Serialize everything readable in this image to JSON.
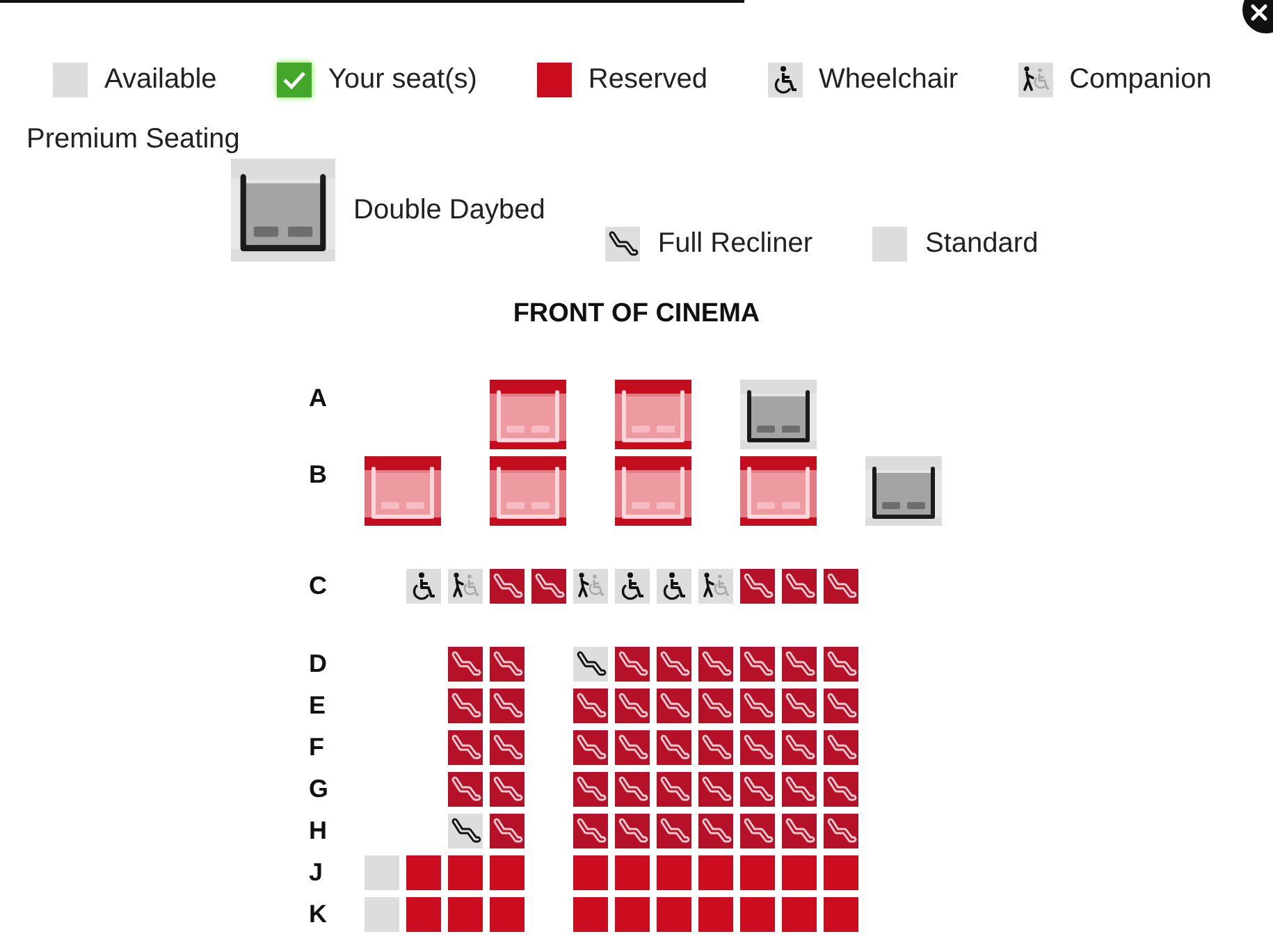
{
  "legend": [
    {
      "kind": "available",
      "label": "Available"
    },
    {
      "kind": "your_seat",
      "label": "Your seat(s)"
    },
    {
      "kind": "reserved",
      "label": "Reserved"
    },
    {
      "kind": "wheelchair",
      "label": "Wheelchair"
    },
    {
      "kind": "companion",
      "label": "Companion"
    }
  ],
  "premium_legend": {
    "title": "Premium Seating",
    "items": [
      {
        "kind": "daybed",
        "label": "Double Daybed"
      },
      {
        "kind": "recliner",
        "label": "Full Recliner"
      },
      {
        "kind": "standard",
        "label": "Standard"
      }
    ]
  },
  "seat_map": {
    "title": "FRONT OF CINEMA",
    "sections": [
      {
        "rows": [
          {
            "label": "A",
            "seats": [
              {
                "kind": "space"
              },
              {
                "kind": "daybed",
                "reserved": true
              },
              {
                "kind": "daybed",
                "reserved": true
              },
              {
                "kind": "daybed",
                "reserved": false
              }
            ]
          },
          {
            "label": "B",
            "seats": [
              {
                "kind": "daybed",
                "reserved": true
              },
              {
                "kind": "daybed",
                "reserved": true
              },
              {
                "kind": "daybed",
                "reserved": true
              },
              {
                "kind": "daybed",
                "reserved": true
              },
              {
                "kind": "daybed",
                "reserved": false
              }
            ]
          }
        ]
      },
      {
        "rows": [
          {
            "label": "C",
            "seats": [
              {
                "kind": "space"
              },
              {
                "kind": "wheelchair",
                "reserved": false
              },
              {
                "kind": "companion",
                "reserved": false
              },
              {
                "kind": "recliner",
                "reserved": true
              },
              {
                "kind": "recliner",
                "reserved": true
              },
              {
                "kind": "companion",
                "reserved": false
              },
              {
                "kind": "wheelchair",
                "reserved": false
              },
              {
                "kind": "wheelchair",
                "reserved": false
              },
              {
                "kind": "companion",
                "reserved": false
              },
              {
                "kind": "recliner",
                "reserved": true
              },
              {
                "kind": "recliner",
                "reserved": true
              },
              {
                "kind": "recliner",
                "reserved": true
              }
            ]
          }
        ]
      },
      {
        "rows": [
          {
            "label": "D",
            "seats": [
              {
                "kind": "space"
              },
              {
                "kind": "space"
              },
              {
                "kind": "recliner",
                "reserved": true
              },
              {
                "kind": "recliner",
                "reserved": true
              },
              {
                "kind": "space"
              },
              {
                "kind": "recliner",
                "reserved": false
              },
              {
                "kind": "recliner",
                "reserved": true
              },
              {
                "kind": "recliner",
                "reserved": true
              },
              {
                "kind": "recliner",
                "reserved": true
              },
              {
                "kind": "recliner",
                "reserved": true
              },
              {
                "kind": "recliner",
                "reserved": true
              },
              {
                "kind": "recliner",
                "reserved": true
              }
            ]
          },
          {
            "label": "E",
            "seats": [
              {
                "kind": "space"
              },
              {
                "kind": "space"
              },
              {
                "kind": "recliner",
                "reserved": true
              },
              {
                "kind": "recliner",
                "reserved": true
              },
              {
                "kind": "space"
              },
              {
                "kind": "recliner",
                "reserved": true
              },
              {
                "kind": "recliner",
                "reserved": true
              },
              {
                "kind": "recliner",
                "reserved": true
              },
              {
                "kind": "recliner",
                "reserved": true
              },
              {
                "kind": "recliner",
                "reserved": true
              },
              {
                "kind": "recliner",
                "reserved": true
              },
              {
                "kind": "recliner",
                "reserved": true
              }
            ]
          },
          {
            "label": "F",
            "seats": [
              {
                "kind": "space"
              },
              {
                "kind": "space"
              },
              {
                "kind": "recliner",
                "reserved": true
              },
              {
                "kind": "recliner",
                "reserved": true
              },
              {
                "kind": "space"
              },
              {
                "kind": "recliner",
                "reserved": true
              },
              {
                "kind": "recliner",
                "reserved": true
              },
              {
                "kind": "recliner",
                "reserved": true
              },
              {
                "kind": "recliner",
                "reserved": true
              },
              {
                "kind": "recliner",
                "reserved": true
              },
              {
                "kind": "recliner",
                "reserved": true
              },
              {
                "kind": "recliner",
                "reserved": true
              }
            ]
          },
          {
            "label": "G",
            "seats": [
              {
                "kind": "space"
              },
              {
                "kind": "space"
              },
              {
                "kind": "recliner",
                "reserved": true
              },
              {
                "kind": "recliner",
                "reserved": true
              },
              {
                "kind": "space"
              },
              {
                "kind": "recliner",
                "reserved": true
              },
              {
                "kind": "recliner",
                "reserved": true
              },
              {
                "kind": "recliner",
                "reserved": true
              },
              {
                "kind": "recliner",
                "reserved": true
              },
              {
                "kind": "recliner",
                "reserved": true
              },
              {
                "kind": "recliner",
                "reserved": true
              },
              {
                "kind": "recliner",
                "reserved": true
              }
            ]
          },
          {
            "label": "H",
            "seats": [
              {
                "kind": "space"
              },
              {
                "kind": "space"
              },
              {
                "kind": "recliner",
                "reserved": false
              },
              {
                "kind": "recliner",
                "reserved": true
              },
              {
                "kind": "space"
              },
              {
                "kind": "recliner",
                "reserved": true
              },
              {
                "kind": "recliner",
                "reserved": true
              },
              {
                "kind": "recliner",
                "reserved": true
              },
              {
                "kind": "recliner",
                "reserved": true
              },
              {
                "kind": "recliner",
                "reserved": true
              },
              {
                "kind": "recliner",
                "reserved": true
              },
              {
                "kind": "recliner",
                "reserved": true
              }
            ]
          },
          {
            "label": "J",
            "seats": [
              {
                "kind": "standard",
                "reserved": false
              },
              {
                "kind": "standard",
                "reserved": true
              },
              {
                "kind": "standard",
                "reserved": true
              },
              {
                "kind": "standard",
                "reserved": true
              },
              {
                "kind": "space"
              },
              {
                "kind": "standard",
                "reserved": true
              },
              {
                "kind": "standard",
                "reserved": true
              },
              {
                "kind": "standard",
                "reserved": true
              },
              {
                "kind": "standard",
                "reserved": true
              },
              {
                "kind": "standard",
                "reserved": true
              },
              {
                "kind": "standard",
                "reserved": true
              },
              {
                "kind": "standard",
                "reserved": true
              }
            ]
          },
          {
            "label": "K",
            "seats": [
              {
                "kind": "standard",
                "reserved": false
              },
              {
                "kind": "standard",
                "reserved": true
              },
              {
                "kind": "standard",
                "reserved": true
              },
              {
                "kind": "standard",
                "reserved": true
              },
              {
                "kind": "space"
              },
              {
                "kind": "standard",
                "reserved": true
              },
              {
                "kind": "standard",
                "reserved": true
              },
              {
                "kind": "standard",
                "reserved": true
              },
              {
                "kind": "standard",
                "reserved": true
              },
              {
                "kind": "standard",
                "reserved": true
              },
              {
                "kind": "standard",
                "reserved": true
              },
              {
                "kind": "standard",
                "reserved": true
              }
            ]
          }
        ]
      }
    ]
  }
}
